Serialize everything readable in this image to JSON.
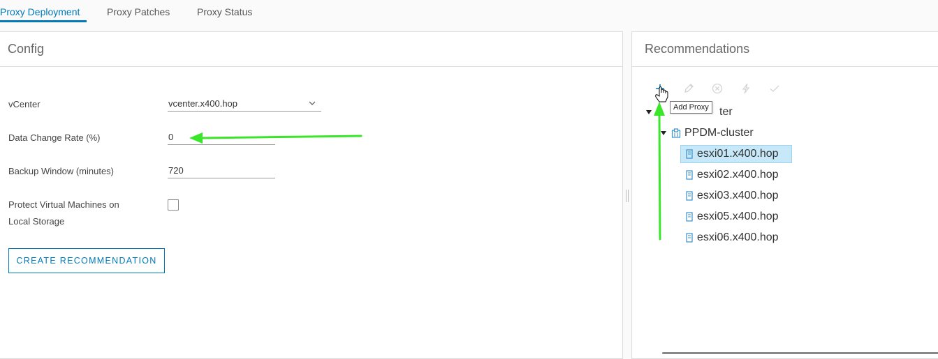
{
  "tabs": [
    {
      "label": "Proxy Deployment",
      "active": true
    },
    {
      "label": "Proxy Patches",
      "active": false
    },
    {
      "label": "Proxy Status",
      "active": false
    }
  ],
  "config": {
    "title": "Config",
    "vcenter_label": "vCenter",
    "vcenter_value": "vcenter.x400.hop",
    "change_rate_label": "Data Change Rate (%)",
    "change_rate_value": "0",
    "backup_window_label": "Backup Window (minutes)",
    "backup_window_value": "720",
    "protect_label_line1": "Protect Virtual Machines on",
    "protect_label_line2": "Local Storage",
    "protect_checked": false,
    "create_button": "CREATE RECOMMENDATION"
  },
  "recommendations": {
    "title": "Recommendations",
    "toolbar": [
      {
        "icon": "plus-icon",
        "enabled": true
      },
      {
        "icon": "pencil-icon",
        "enabled": false
      },
      {
        "icon": "delete-circle-icon",
        "enabled": false
      },
      {
        "icon": "lightning-icon",
        "enabled": false
      },
      {
        "icon": "checkmark-icon",
        "enabled": false
      }
    ],
    "tooltip": "Add Proxy",
    "tree": {
      "root_partial": "ter",
      "cluster": "PPDM-cluster",
      "hosts": [
        {
          "name": "esxi01.x400.hop",
          "selected": true
        },
        {
          "name": "esxi02.x400.hop",
          "selected": false
        },
        {
          "name": "esxi03.x400.hop",
          "selected": false
        },
        {
          "name": "esxi05.x400.hop",
          "selected": false
        },
        {
          "name": "esxi06.x400.hop",
          "selected": false
        }
      ]
    }
  },
  "colors": {
    "accent": "#0079b8",
    "selected_row": "#c7e8f8",
    "annotation_arrow": "#39e629"
  }
}
